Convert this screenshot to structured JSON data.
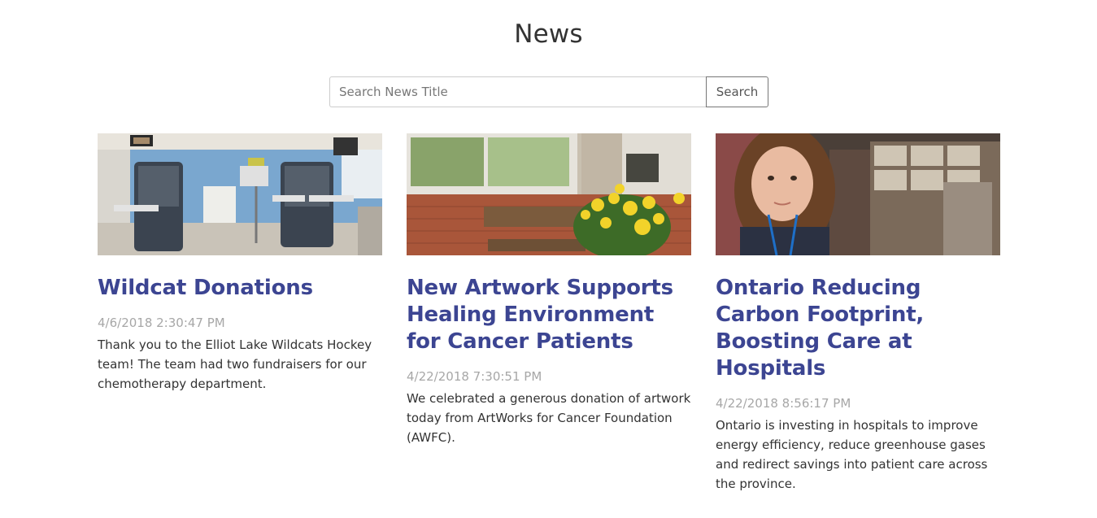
{
  "page": {
    "title": "News"
  },
  "search": {
    "placeholder": "Search News Title",
    "button_label": "Search"
  },
  "articles": [
    {
      "title": "Wildcat Donations",
      "date": "4/6/2018 2:30:47 PM",
      "summary": "Thank you to the Elliot Lake Wildcats Hockey team! The team had two fundraisers for our chemotherapy department."
    },
    {
      "title": "New Artwork Supports Healing Environment for Cancer Patients",
      "date": "4/22/2018 7:30:51 PM",
      "summary": "We celebrated a generous donation of artwork today from ArtWorks for Cancer Foundation (AWFC)."
    },
    {
      "title": "Ontario Reducing Carbon Footprint, Boosting Care at Hospitals",
      "date": "4/22/2018 8:56:17 PM",
      "summary": "Ontario is investing in hospitals to improve energy efficiency, reduce greenhouse gases and redirect savings into patient care across the province."
    }
  ],
  "colors": {
    "title_link": "#3c4592",
    "date": "#a7a7a7"
  }
}
